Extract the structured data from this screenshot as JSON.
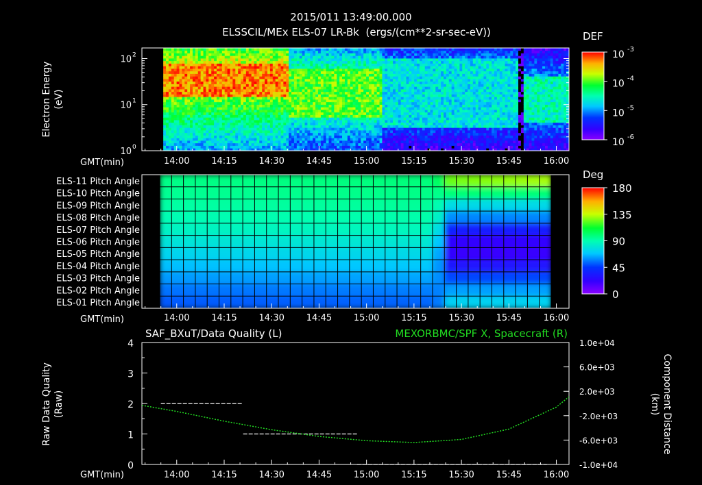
{
  "header": {
    "timestamp": "2015/011 13:49:00.000",
    "subtitle": "ELSSCIL/MEx ELS-07 LR-Bk  (ergs/(cm**2-sr-sec-eV))"
  },
  "panel1": {
    "ylabel_line1": "Electron Energy",
    "ylabel_line2": "(eV)",
    "yticks": [
      "10",
      "10",
      "10"
    ],
    "ytick_exponents": [
      "0",
      "1",
      "2"
    ],
    "colorbar_title": "DEF",
    "colorbar_ticks": [
      "10",
      "10",
      "10",
      "10"
    ],
    "colorbar_exponents": [
      "-3",
      "-4",
      "-5",
      "-6"
    ],
    "xaxis_label": "GMT(min)"
  },
  "panel2": {
    "row_labels": [
      "ELS-11 Pitch Angle",
      "ELS-10 Pitch Angle",
      "ELS-09 Pitch Angle",
      "ELS-08 Pitch Angle",
      "ELS-07 Pitch Angle",
      "ELS-06 Pitch Angle",
      "ELS-05 Pitch Angle",
      "ELS-04 Pitch Angle",
      "ELS-03 Pitch Angle",
      "ELS-02 Pitch Angle",
      "ELS-01 Pitch Angle"
    ],
    "colorbar_title": "Deg",
    "colorbar_ticks": [
      "180",
      "135",
      "90",
      "45",
      "0"
    ],
    "xaxis_label": "GMT(min)"
  },
  "panel3": {
    "left_title": "SAF_BXuT/Data Quality (L)",
    "right_title": "MEXORBMC/SPF X, Spacecraft (R)",
    "ylabel_left_line1": "Raw Data Quality",
    "ylabel_left_line2": "(Raw)",
    "ylabel_right_line1": "Component Distance",
    "ylabel_right_line2": "(km)",
    "left_ticks": [
      "4",
      "3",
      "2",
      "1",
      "0"
    ],
    "right_ticks": [
      "1.0e+04",
      "6.0e+03",
      "2.0e+03",
      "-2.0e+03",
      "-6.0e+03",
      "-1.0e+04"
    ],
    "xaxis_label": "GMT(min)"
  },
  "time_axis": {
    "labels": [
      "14:00",
      "14:15",
      "14:30",
      "14:45",
      "15:00",
      "15:15",
      "15:30",
      "15:45",
      "16:00"
    ]
  },
  "colors": {
    "background": "#000000",
    "axis": "#ffffff",
    "right_series": "#22dd22"
  },
  "chart_data": [
    {
      "type": "heatmap",
      "title": "ELSSCIL/MEx ELS-07 LR-Bk  (ergs/(cm**2-sr-sec-eV))",
      "xlabel": "GMT(min)",
      "ylabel": "Electron Energy (eV)",
      "x_range": [
        "13:49",
        "16:04"
      ],
      "y_range": [
        1,
        170
      ],
      "y_scale": "log",
      "color_label": "DEF",
      "color_range": [
        1e-06,
        0.001
      ],
      "features": [
        {
          "time": "13:56-14:35",
          "energy_eV": "15-80",
          "level": 0.0005
        },
        {
          "time": "14:35-15:05",
          "energy_eV": "5-60",
          "level": 0.0001
        },
        {
          "time": "15:05-15:48",
          "energy_eV": "3-100",
          "level": 2e-05
        },
        {
          "time": "15:48-15:50",
          "energy_eV": "1-170",
          "level": 1e-06
        },
        {
          "time": "15:50-16:04",
          "energy_eV": "4-40",
          "level": 3e-05
        }
      ]
    },
    {
      "type": "heatmap",
      "xlabel": "GMT(min)",
      "color_label": "Deg",
      "color_range": [
        0,
        180
      ],
      "x_range": [
        "13:55",
        "16:00"
      ],
      "rows": [
        "ELS-11",
        "ELS-10",
        "ELS-09",
        "ELS-08",
        "ELS-07",
        "ELS-06",
        "ELS-05",
        "ELS-04",
        "ELS-03",
        "ELS-02",
        "ELS-01"
      ],
      "values_deg_before_1523": [
        98,
        96,
        93,
        90,
        86,
        80,
        74,
        68,
        62,
        56,
        52
      ],
      "values_deg_after_1528": [
        125,
        100,
        75,
        58,
        35,
        22,
        20,
        30,
        48,
        62,
        72
      ]
    },
    {
      "type": "line",
      "title_left": "SAF_BXuT/Data Quality (L)",
      "title_right": "MEXORBMC/SPF X, Spacecraft (R)",
      "xlabel": "GMT(min)",
      "ylabel_left": "Raw Data Quality (Raw)",
      "ylabel_right": "Component Distance (km)",
      "ylim_left": [
        0,
        4
      ],
      "ylim_right": [
        -10000,
        10000
      ],
      "series": [
        {
          "name": "SAF_BXuT/Data Quality",
          "axis": "left",
          "style": "dashed",
          "segments": [
            {
              "start": "13:55",
              "end": "14:21",
              "value": 2
            },
            {
              "start": "14:21",
              "end": "14:57",
              "value": 1
            },
            {
              "start": "14:57",
              "end": "15:57",
              "value": 0
            }
          ]
        },
        {
          "name": "MEXORBMC/SPF X, Spacecraft",
          "axis": "right",
          "style": "dotted",
          "x": [
            "13:49",
            "14:00",
            "14:15",
            "14:30",
            "14:45",
            "15:00",
            "15:15",
            "15:30",
            "15:45",
            "16:00",
            "16:04"
          ],
          "values": [
            -300,
            -1300,
            -2900,
            -4300,
            -5400,
            -6100,
            -6400,
            -5900,
            -4200,
            -600,
            1100
          ]
        }
      ]
    }
  ]
}
